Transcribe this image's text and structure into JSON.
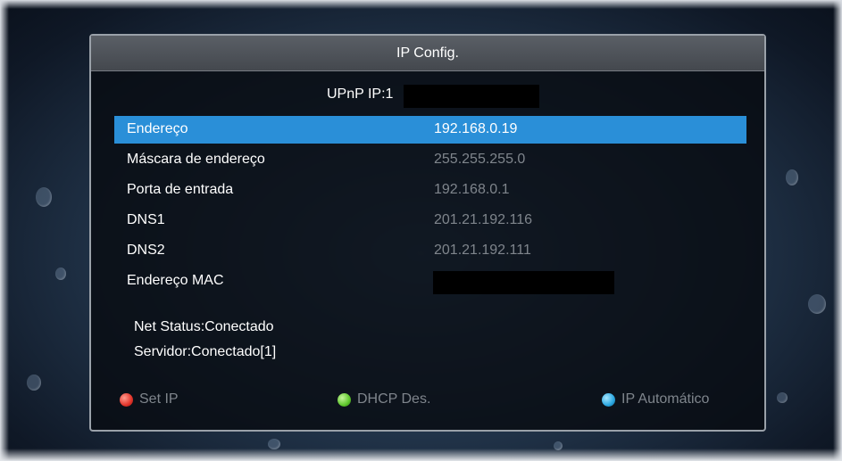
{
  "dialog": {
    "title": "IP Config."
  },
  "upnp": {
    "label": "UPnP IP:1"
  },
  "rows": [
    {
      "label": "Endereço",
      "value": "192.168.0.19"
    },
    {
      "label": "Máscara de endereço",
      "value": "255.255.255.0"
    },
    {
      "label": "Porta de entrada",
      "value": "192.168.0.1"
    },
    {
      "label": "DNS1",
      "value": "201.21.192.116"
    },
    {
      "label": "DNS2",
      "value": "201.21.192.111"
    },
    {
      "label": "Endereço MAC",
      "value": ""
    }
  ],
  "status": {
    "net": "Net Status:Conectado",
    "server": "Servidor:Conectado[1]"
  },
  "keys": {
    "red": {
      "label": "Set IP",
      "color": "#e2342a"
    },
    "green": {
      "label": "DHCP Des.",
      "color": "#5ec72c"
    },
    "blue": {
      "label": "IP Automático",
      "color": "#2aa6e0"
    }
  },
  "colors": {
    "selection": "#2a8fd8",
    "value_text": "#7f858c"
  }
}
